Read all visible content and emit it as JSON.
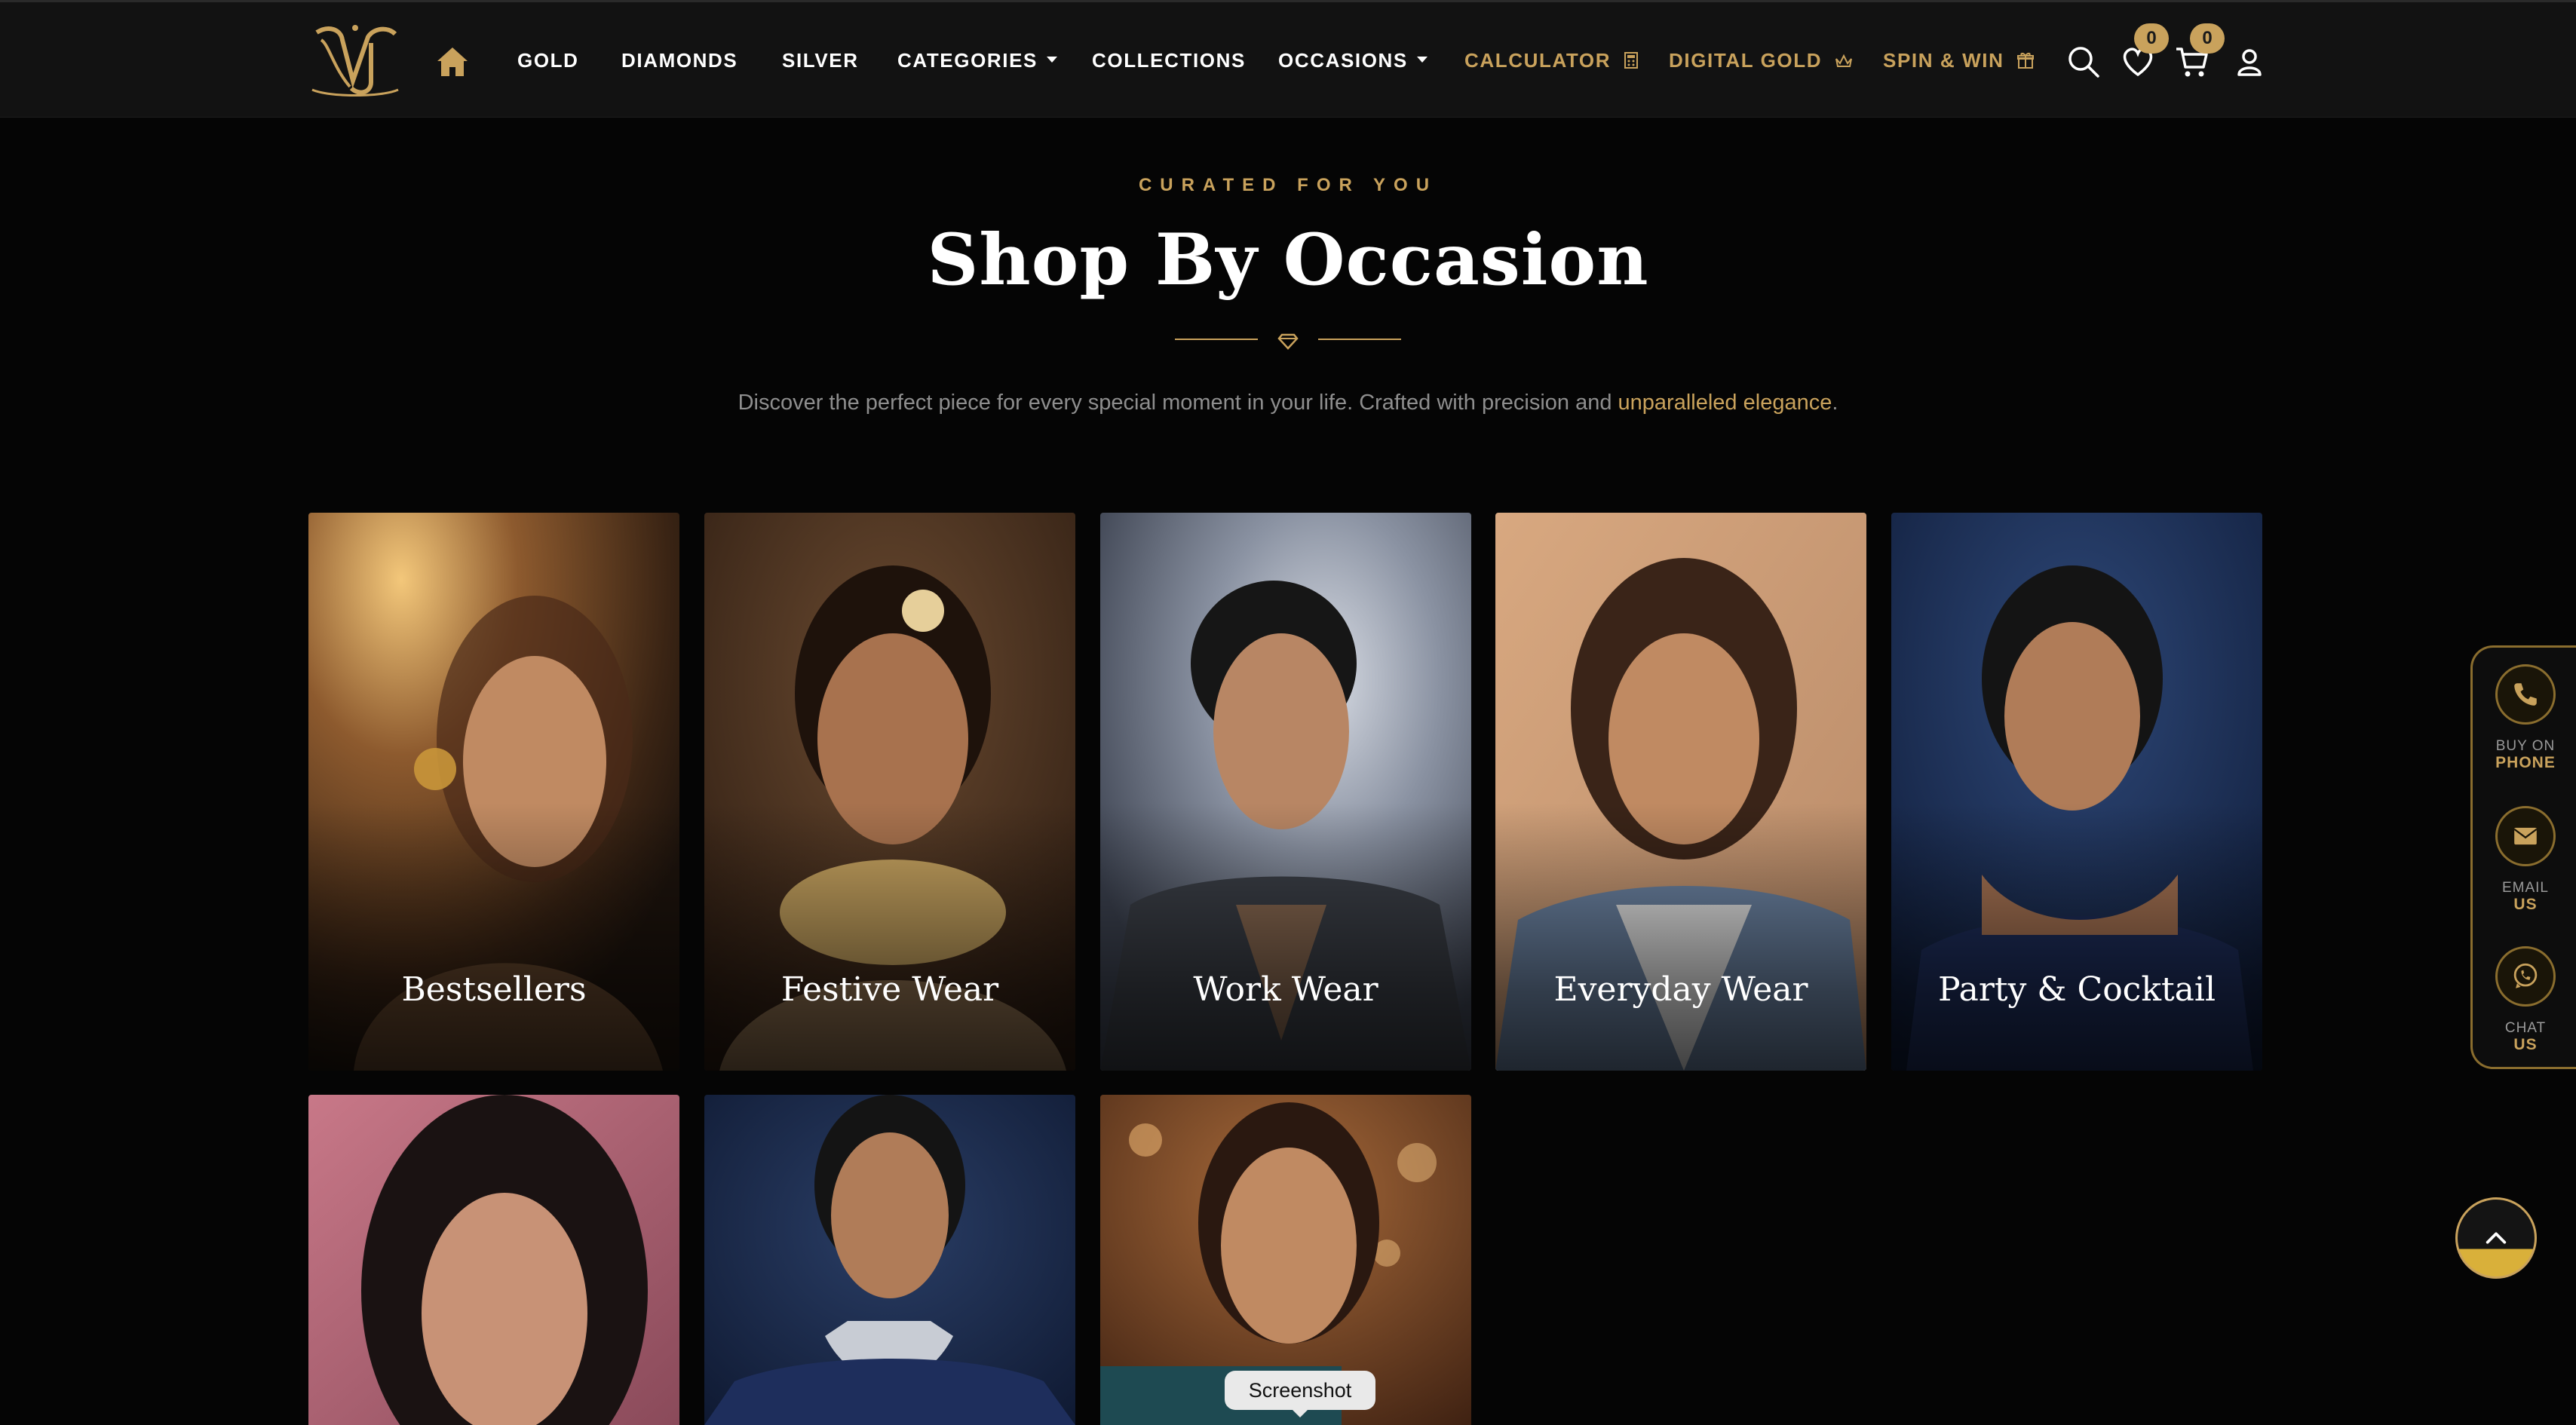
{
  "nav": {
    "items": [
      {
        "label": "GOLD"
      },
      {
        "label": "DIAMONDS"
      },
      {
        "label": "SILVER"
      },
      {
        "label": "CATEGORIES",
        "dropdown": true
      },
      {
        "label": "COLLECTIONS"
      },
      {
        "label": "OCCASIONS",
        "dropdown": true
      },
      {
        "label": "CALCULATOR",
        "icon": "calculator-icon",
        "accent": true
      },
      {
        "label": "DIGITAL GOLD",
        "icon": "crown-icon",
        "accent": true
      },
      {
        "label": "SPIN & WIN",
        "icon": "gift-icon",
        "accent": true
      }
    ],
    "wishlist_count": "0",
    "cart_count": "0"
  },
  "section": {
    "eyebrow": "CURATED FOR YOU",
    "title": "Shop By Occasion",
    "subtitle_prefix": "Discover the perfect piece for every special moment in your life. Crafted with precision and ",
    "subtitle_accent": "unparalleled elegance",
    "subtitle_suffix": "."
  },
  "cards": [
    {
      "label": "Bestsellers"
    },
    {
      "label": "Festive Wear"
    },
    {
      "label": "Work Wear"
    },
    {
      "label": "Everyday Wear"
    },
    {
      "label": "Party & Cocktail"
    },
    {
      "label": ""
    },
    {
      "label": ""
    },
    {
      "label": ""
    }
  ],
  "dock": {
    "phone_top": "BUY ON",
    "phone_bottom": "PHONE",
    "email_top": "EMAIL",
    "email_bottom": "US",
    "chat_top": "CHAT",
    "chat_bottom": "US"
  },
  "tooltip": "Screenshot",
  "colors": {
    "accent": "#c9a25c",
    "background": "#050505",
    "navbar": "#121212"
  }
}
